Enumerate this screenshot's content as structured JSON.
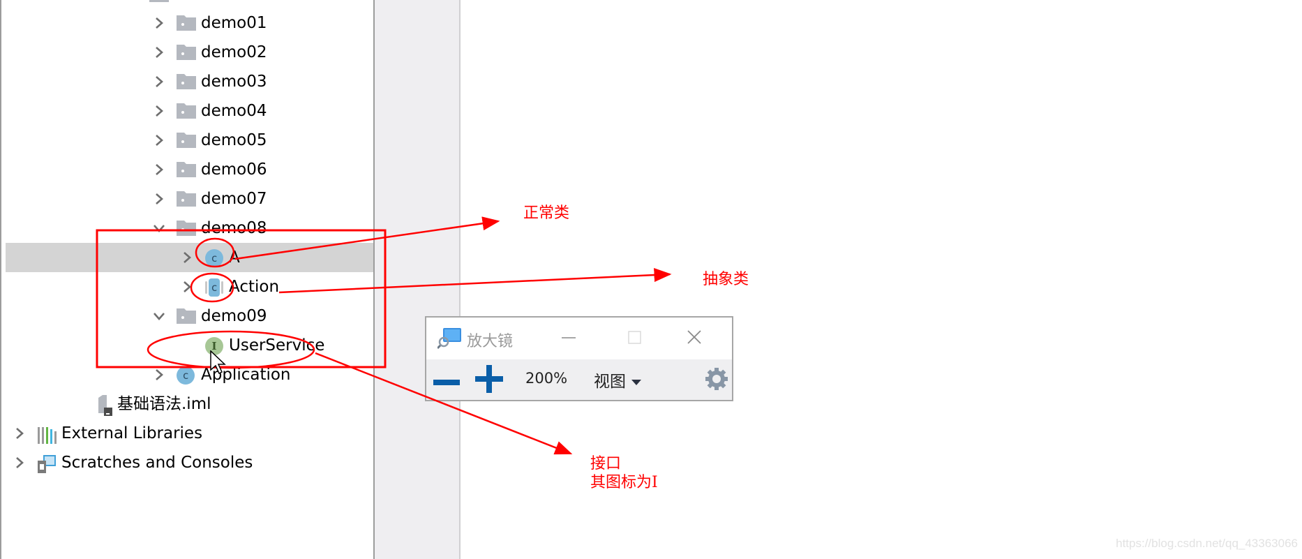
{
  "project_tree": {
    "partial_top_item": "...",
    "items": [
      {
        "label": "demo01",
        "type": "package",
        "expanded": false
      },
      {
        "label": "demo02",
        "type": "package",
        "expanded": false
      },
      {
        "label": "demo03",
        "type": "package",
        "expanded": false
      },
      {
        "label": "demo04",
        "type": "package",
        "expanded": false
      },
      {
        "label": "demo05",
        "type": "package",
        "expanded": false
      },
      {
        "label": "demo06",
        "type": "package",
        "expanded": false
      },
      {
        "label": "demo07",
        "type": "package",
        "expanded": false
      },
      {
        "label": "demo08",
        "type": "package",
        "expanded": true
      },
      {
        "label": "A",
        "type": "class",
        "selected": true
      },
      {
        "label": "Action",
        "type": "abstract-class"
      },
      {
        "label": "demo09",
        "type": "package",
        "expanded": true
      },
      {
        "label": "UserService",
        "type": "interface"
      },
      {
        "label": "Application",
        "type": "class"
      },
      {
        "label": "基础语法.iml",
        "type": "module-file"
      },
      {
        "label": "External Libraries",
        "type": "libraries"
      },
      {
        "label": "Scratches and Consoles",
        "type": "scratches"
      }
    ],
    "icon_letters": {
      "class": "c",
      "interface": "I"
    }
  },
  "magnifier": {
    "title": "放大镜",
    "zoom_out_icon": "minus-icon",
    "zoom_in_icon": "plus-icon",
    "zoom_level": "200%",
    "view_menu_label": "视图",
    "settings_icon": "gear-icon",
    "minimize_icon": "minimize-icon",
    "maximize_icon": "maximize-icon",
    "close_icon": "close-icon",
    "accent_color": "#0a5ea8"
  },
  "annotations": {
    "normal_class": "正常类",
    "abstract_class": "抽象类",
    "interface_line1": "接口",
    "interface_line2": "其图标为I",
    "color": "#ff0000"
  },
  "watermark": "https://blog.csdn.net/qq_43363066"
}
